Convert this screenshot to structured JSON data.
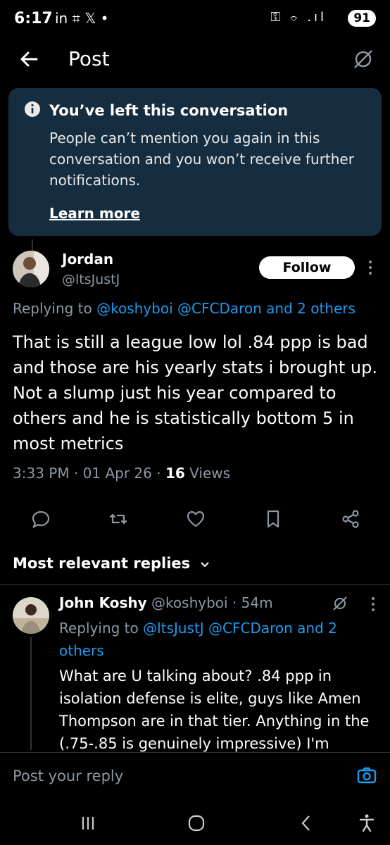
{
  "status_bar": {
    "time": "6:17",
    "left_icons": "in ⌗ 𝕏 •",
    "right_icons": "⚿ ⌔ .ıl",
    "battery": "91"
  },
  "header": {
    "title": "Post"
  },
  "banner": {
    "title": "You’ve left this conversation",
    "body": "People can’t mention you again in this conversation and you won’t receive further notifications.",
    "link": "Learn more"
  },
  "post": {
    "author_name": "Jordan",
    "author_handle": "@ltsJustJ",
    "follow_label": "Follow",
    "replying_prefix": "Replying to ",
    "replying_targets": "@koshyboi @CFCDaron and 2 others",
    "text": "That is still a league low lol .84 ppp is bad and those are his yearly stats i brought up. Not a slump just his year compared to others and he is statistically bottom 5 in most metrics",
    "time": "3:33 PM · 01 Apr 26 · ",
    "views_count": "16",
    "views_label": " Views"
  },
  "replies_label": "Most relevant replies",
  "reply": {
    "name": "John Koshy",
    "handle_time": " @koshyboi · 54m",
    "replying_prefix": "Replying to ",
    "replying_targets": "@ltsJustJ @CFCDaron and 2 others",
    "text": "What are U talking about? .84 ppp in isolation defense is elite, guys like Amen Thompson are in that tier. Anything in the (.75-.85 is genuinely impressive) I'm"
  },
  "composer": {
    "placeholder": "Post your reply"
  },
  "colors": {
    "accent": "#1d9bf0",
    "banner_bg": "#162d40",
    "muted": "#8b98a5"
  }
}
